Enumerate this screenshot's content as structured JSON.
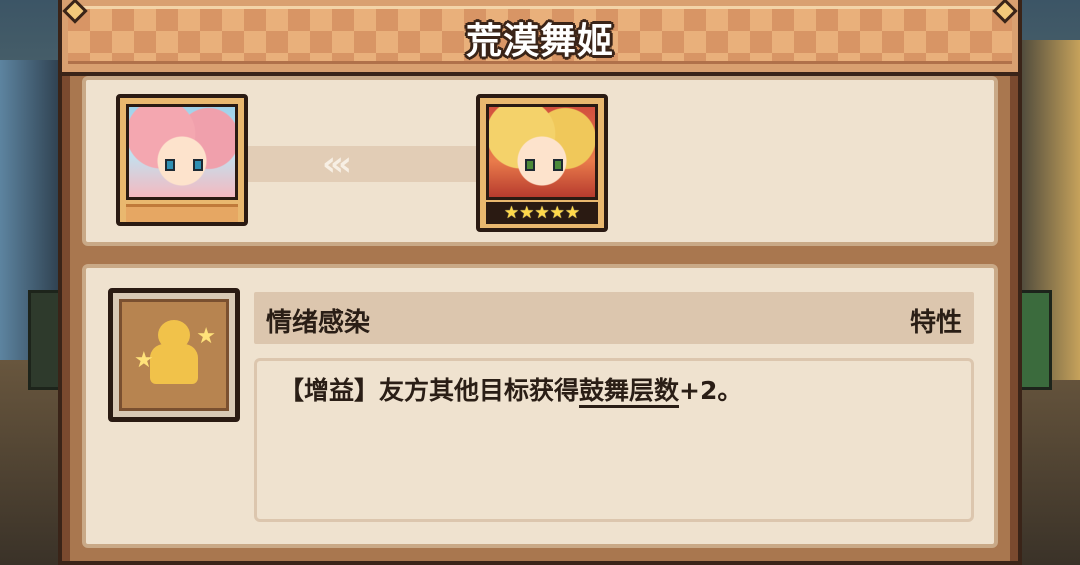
{
  "window": {
    "title": "荒漠舞姬"
  },
  "evolution": {
    "from_portrait": "character-portrait-pink-hair",
    "to_portrait": "character-portrait-blonde-hair",
    "arrow_glyph": "‹‹‹",
    "to_stars": "★★★★★",
    "star_count": 5
  },
  "skill": {
    "icon": "golden-figure-skill-icon",
    "name": "情绪感染",
    "type": "特性",
    "description_prefix": "【增益】友方其他目标获得",
    "description_keyword": "鼓舞层数",
    "description_suffix": "+2。"
  },
  "colors": {
    "panel_border": "#3a2418",
    "panel_fill": "#efe2cf",
    "banner": "#d89565",
    "text": "#2a1e16",
    "stars": "#ffd84a"
  }
}
